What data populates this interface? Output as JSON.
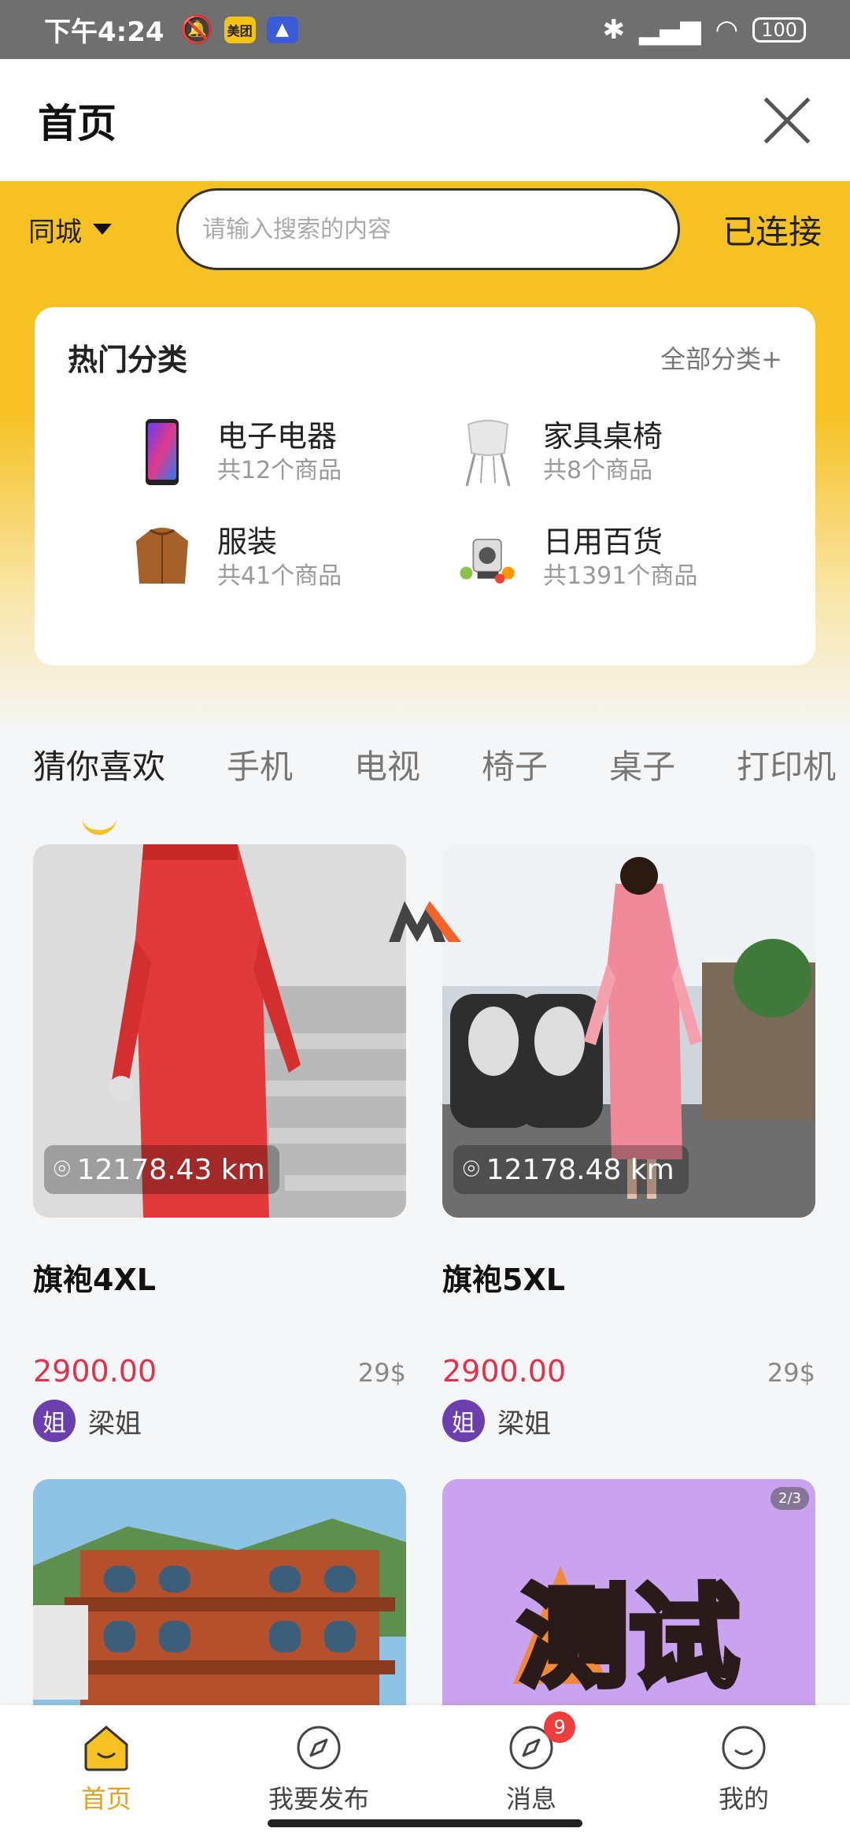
{
  "status_bar": {
    "time": "下午4:24",
    "battery": "100",
    "app_icon_1": "美团"
  },
  "header": {
    "title": "首页"
  },
  "search": {
    "city": "同城",
    "placeholder": "请输入搜索的内容",
    "status": "已连接"
  },
  "categories": {
    "title": "热门分类",
    "all_label": "全部分类+",
    "items": [
      {
        "name": "电子电器",
        "count": "共12个商品",
        "icon": "phone-icon"
      },
      {
        "name": "家具桌椅",
        "count": "共8个商品",
        "icon": "chair-icon"
      },
      {
        "name": "服装",
        "count": "共41个商品",
        "icon": "jacket-icon"
      },
      {
        "name": "日用百货",
        "count": "共1391个商品",
        "icon": "appliance-icon"
      }
    ]
  },
  "tabs": [
    "猜你喜欢",
    "手机",
    "电视",
    "椅子",
    "桌子",
    "打印机"
  ],
  "products": [
    {
      "name": "旗袍4XL",
      "distance": "12178.43 km",
      "price": "2900.00",
      "usd": "29$",
      "seller_initial": "姐",
      "seller": "梁姐"
    },
    {
      "name": "旗袍5XL",
      "distance": "12178.48 km",
      "price": "2900.00",
      "usd": "29$",
      "seller_initial": "姐",
      "seller": "梁姐"
    }
  ],
  "product_partial": {
    "test_text": "测试",
    "page_indicator": "2/3"
  },
  "tabbar": [
    {
      "label": "首页",
      "icon": "home-icon"
    },
    {
      "label": "我要发布",
      "icon": "compass-icon"
    },
    {
      "label": "消息",
      "icon": "compass-icon",
      "badge": "9"
    },
    {
      "label": "我的",
      "icon": "smile-icon"
    }
  ],
  "colors": {
    "accent": "#f6c123",
    "price": "#e0324b",
    "active_tab": "#e8a21a"
  }
}
